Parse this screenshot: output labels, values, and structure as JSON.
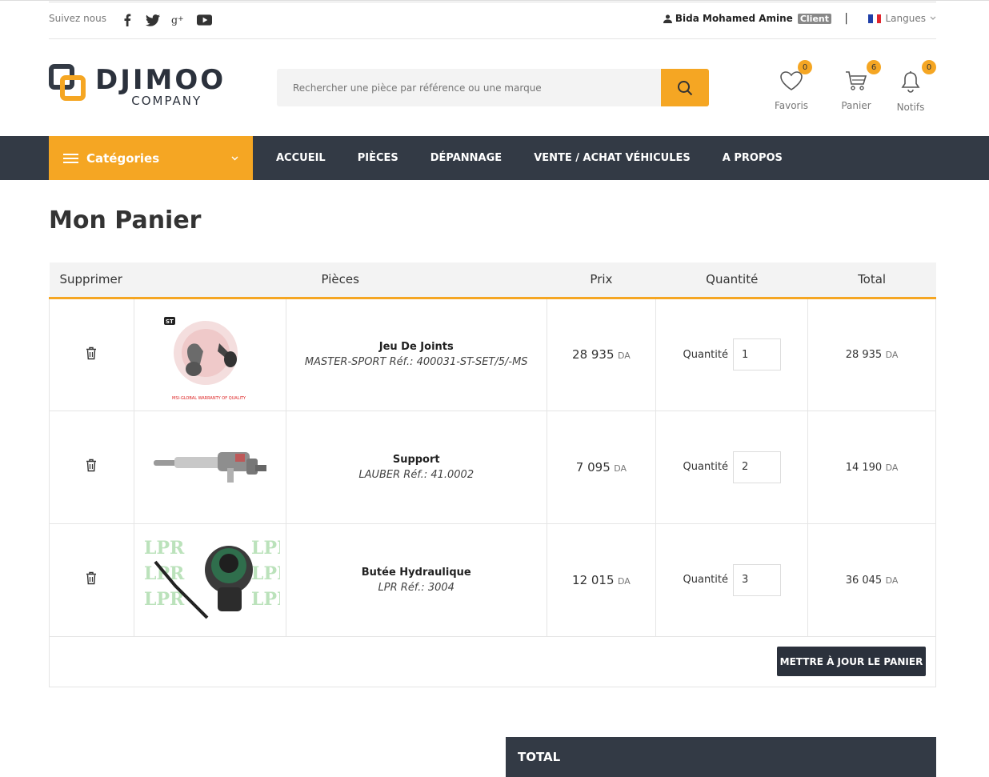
{
  "topbar": {
    "follow_label": "Suivez nous",
    "user_name": "Bida Mohamed Amine",
    "user_badge": "Client",
    "separator": "|",
    "lang_label": "Langues"
  },
  "search": {
    "placeholder": "Rechercher une pièce par référence ou une marque"
  },
  "header_icons": {
    "favoris": {
      "label": "Favoris",
      "count": "0"
    },
    "panier": {
      "label": "Panier",
      "count": "6"
    },
    "notifs": {
      "label": "Notifs",
      "count": "0"
    }
  },
  "logo": {
    "line1": "DJIMOO",
    "line2": "COMPANY"
  },
  "nav": {
    "categories_label": "Catégories",
    "items": [
      "ACCUEIL",
      "PIÈCES",
      "DÉPANNAGE",
      "VENTE / ACHAT VÉHICULES",
      "A PROPOS"
    ]
  },
  "page": {
    "title": "Mon Panier"
  },
  "table": {
    "headers": [
      "Supprimer",
      "Pièces",
      "Prix",
      "Quantité",
      "Total"
    ],
    "quantity_label": "Quantité",
    "currency": "DA",
    "rows": [
      {
        "name": "Jeu De Joints",
        "ref": "MASTER-SPORT Réf.: 400031-ST-SET/5/-MS",
        "price": "28 935",
        "qty": "1",
        "total": "28 935",
        "img_tag": "ST",
        "img_caption": "MSI-GLOBAL WARRANTY OF QUALITY"
      },
      {
        "name": "Support",
        "ref": "LAUBER Réf.: 41.0002",
        "price": "7 095",
        "qty": "2",
        "total": "14 190"
      },
      {
        "name": "Butée Hydraulique",
        "ref": "LPR Réf.: 3004",
        "price": "12 015",
        "qty": "3",
        "total": "36 045",
        "img_wm": "LPR"
      }
    ],
    "update_button": "METTRE À JOUR LE PANIER"
  },
  "totals": {
    "title": "TOTAL"
  },
  "colors": {
    "accent": "#f5a623",
    "dark": "#333a45"
  }
}
